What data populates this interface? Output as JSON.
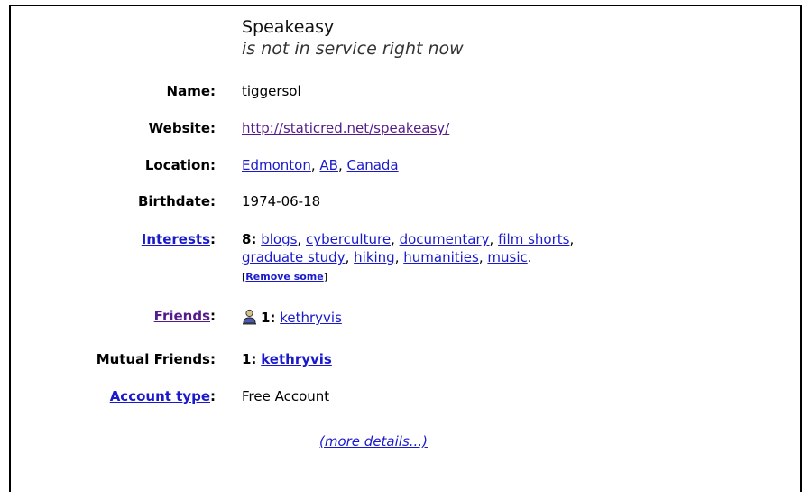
{
  "header": {
    "name": "Speakeasy",
    "status": "is not in service right now"
  },
  "fields": {
    "name": {
      "label": "Name:",
      "value": "tiggersol"
    },
    "website": {
      "label": "Website:",
      "value": "http://staticred.net/speakeasy/"
    },
    "location": {
      "label": "Location:",
      "city": "Edmonton",
      "region": "AB",
      "country": "Canada",
      "sep": ", "
    },
    "birthdate": {
      "label": "Birthdate:",
      "value": "1974-06-18"
    },
    "interests": {
      "label": "Interests",
      "colon": ":",
      "count": "8:",
      "items": [
        "blogs",
        "cyberculture",
        "documentary",
        "film shorts",
        "graduate study",
        "hiking",
        "humanities",
        "music"
      ],
      "remove_link": "Remove some",
      "open_bracket": "[",
      "close_bracket": "]"
    },
    "friends": {
      "label": "Friends",
      "colon": ":",
      "count": "1:",
      "name": "kethryvis"
    },
    "mutual_friends": {
      "label": "Mutual Friends:",
      "count": "1:",
      "name": "kethryvis"
    },
    "account_type": {
      "label": "Account type",
      "colon": ":",
      "value": "Free Account"
    }
  },
  "more_details": "(more details...)",
  "icons": {
    "friend": "person-icon"
  },
  "colors": {
    "link": "#1a1acc",
    "visited": "#551a8b"
  }
}
